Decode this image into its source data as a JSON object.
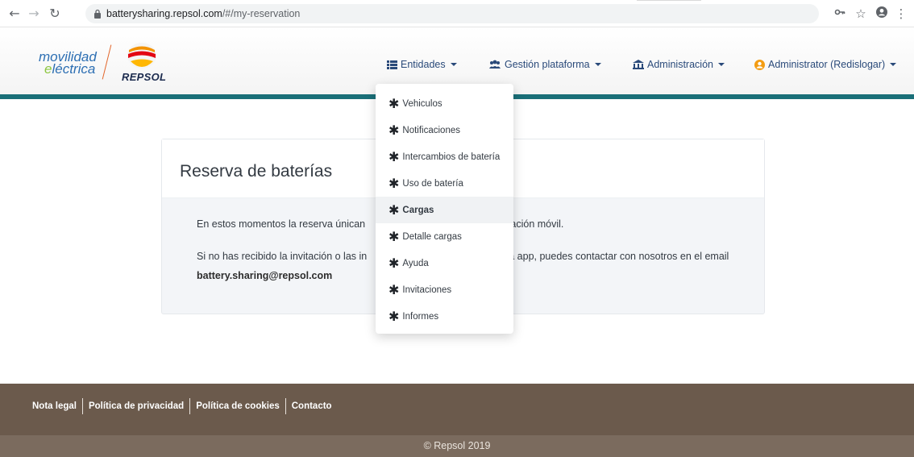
{
  "browser": {
    "url_host": "batterysharing.repsol.com",
    "url_path": "/#/my-reservation"
  },
  "header": {
    "logo_line1": "movilidad",
    "logo_line2_accent": "e",
    "logo_line2_rest": "léctrica",
    "brand": "REPSOL",
    "nav": {
      "entidades": "Entidades",
      "gestion": "Gestión plataforma",
      "administracion": "Administración",
      "user": "Administrator (Redislogar)"
    }
  },
  "colors": {
    "accent_bar": "#1a6f78",
    "footer": "#6b5a4c",
    "nav_text": "#2a4a7a"
  },
  "dropdown": {
    "items": [
      "Vehiculos",
      "Notificaciones",
      "Intercambios de batería",
      "Uso de batería",
      "Cargas",
      "Detalle cargas",
      "Ayuda",
      "Invitaciones",
      "Informes"
    ],
    "star": "✱"
  },
  "card": {
    "title": "Reserva de baterías",
    "p1_a": "En estos momentos la reserva únican",
    "p1_b": "cación móvil.",
    "p2_a": "Si no has recibido la invitación o las in",
    "p2_b": "a app, puedes contactar con nosotros en el email",
    "email": "battery.sharing@repsol.com"
  },
  "footer": {
    "links": [
      "Nota legal",
      "Política de privacidad",
      "Política de cookies",
      "Contacto"
    ],
    "copyright": "© Repsol 2019"
  }
}
